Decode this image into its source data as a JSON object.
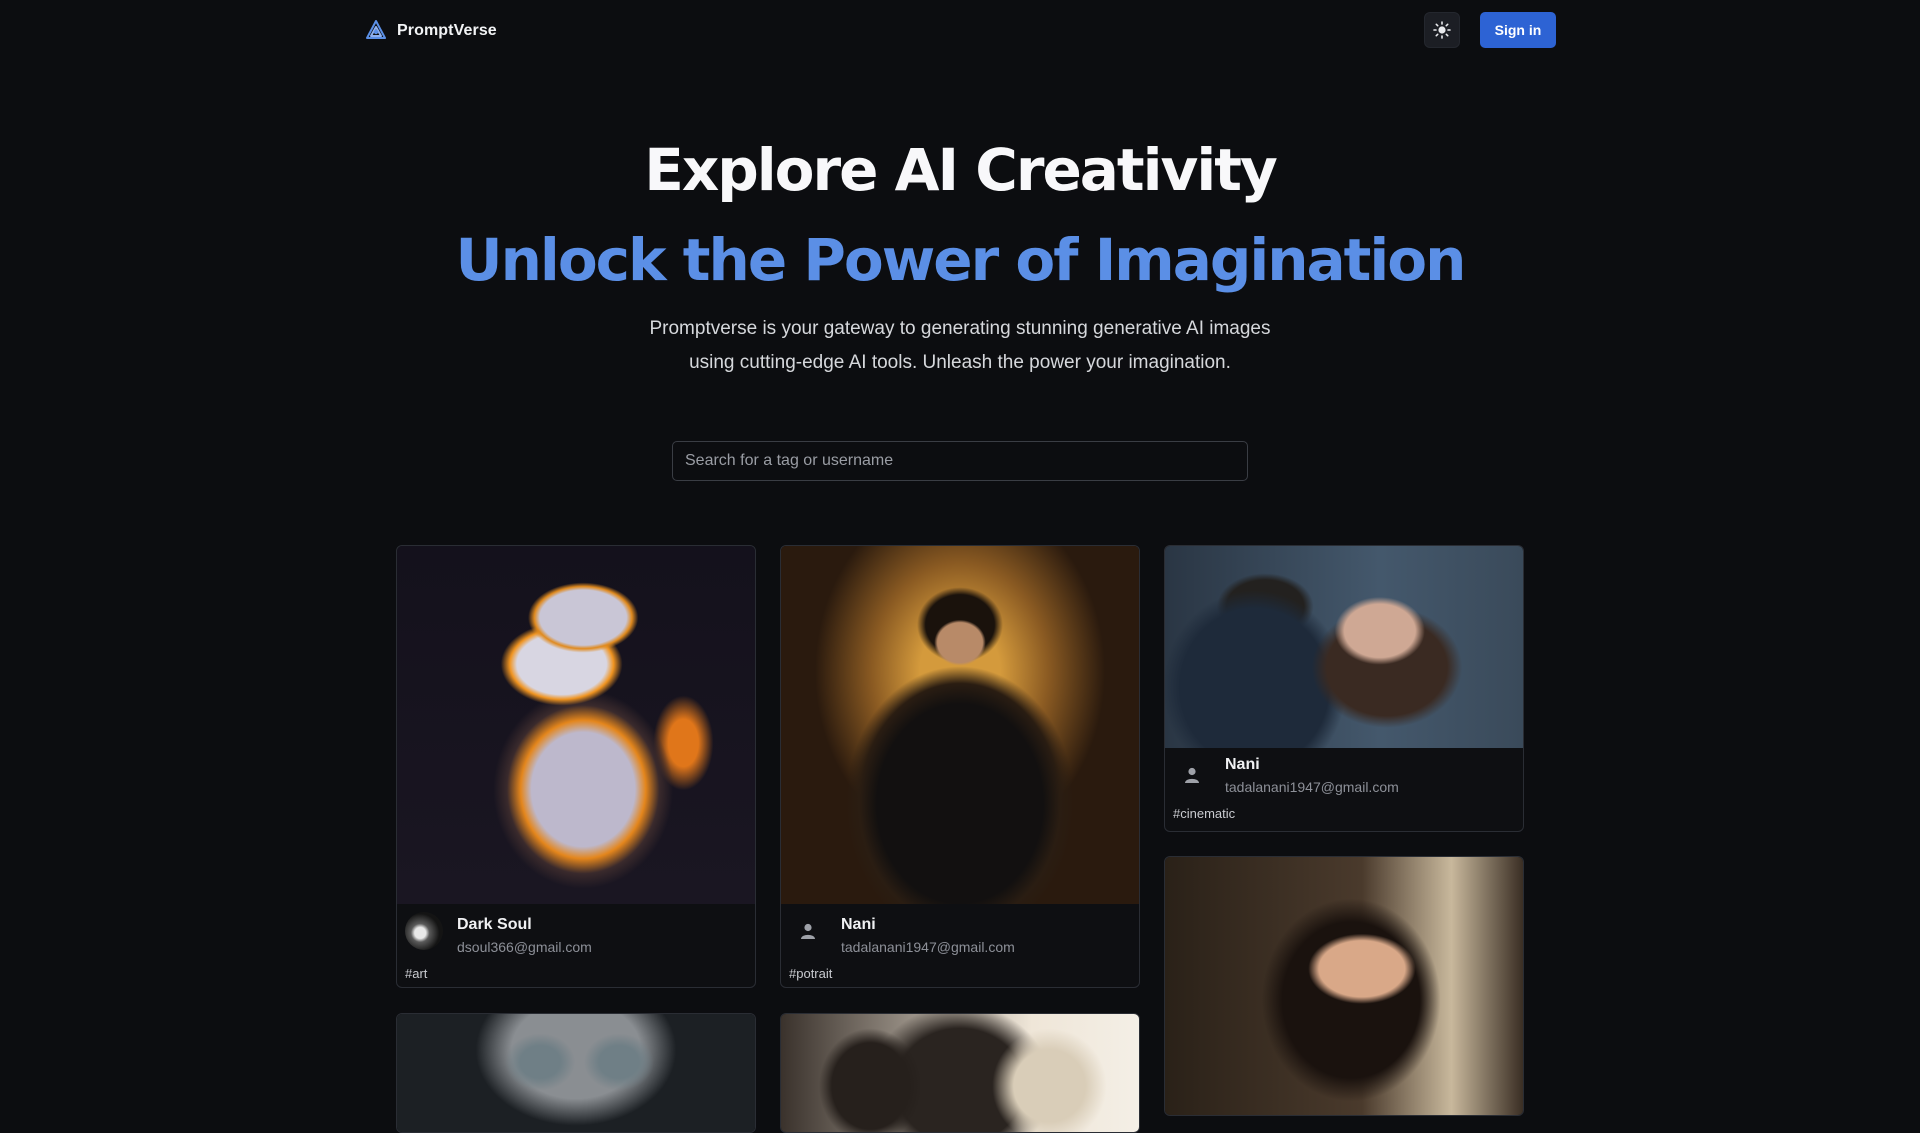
{
  "brand": {
    "name": "PromptVerse",
    "logo_icon": "triangle-knot-logo-icon"
  },
  "nav": {
    "theme_toggle_icon": "sun-icon",
    "signin_label": "Sign in"
  },
  "hero": {
    "title": "Explore AI Creativity",
    "subtitle": "Unlock the Power of Imagination",
    "description": "Promptverse is your gateway to generating stunning generative AI images using cutting-edge AI tools. Unleash the power your imagination."
  },
  "search": {
    "placeholder": "Search for a tag or username",
    "value": ""
  },
  "colors": {
    "accent": "#2d63d4",
    "subtitle": "#5b8fe6",
    "background": "#0c0d10"
  },
  "posts": [
    {
      "name": "Dark Soul",
      "email": "dsoul366@gmail.com",
      "tag": "#art",
      "image": "armored trooper"
    },
    {
      "name": "Nani",
      "email": "tadalanani1947@gmail.com",
      "tag": "#potrait",
      "image": "queen on throne"
    },
    {
      "name": "Nani",
      "email": "tadalanani1947@gmail.com",
      "tag": "#cinematic",
      "image": "couple scene"
    },
    {
      "name": "",
      "email": "",
      "tag": "",
      "image": "woman portrait"
    },
    {
      "name": "",
      "email": "",
      "tag": "",
      "image": "hooded face"
    },
    {
      "name": "",
      "email": "",
      "tag": "",
      "image": "curly hair woman"
    }
  ]
}
